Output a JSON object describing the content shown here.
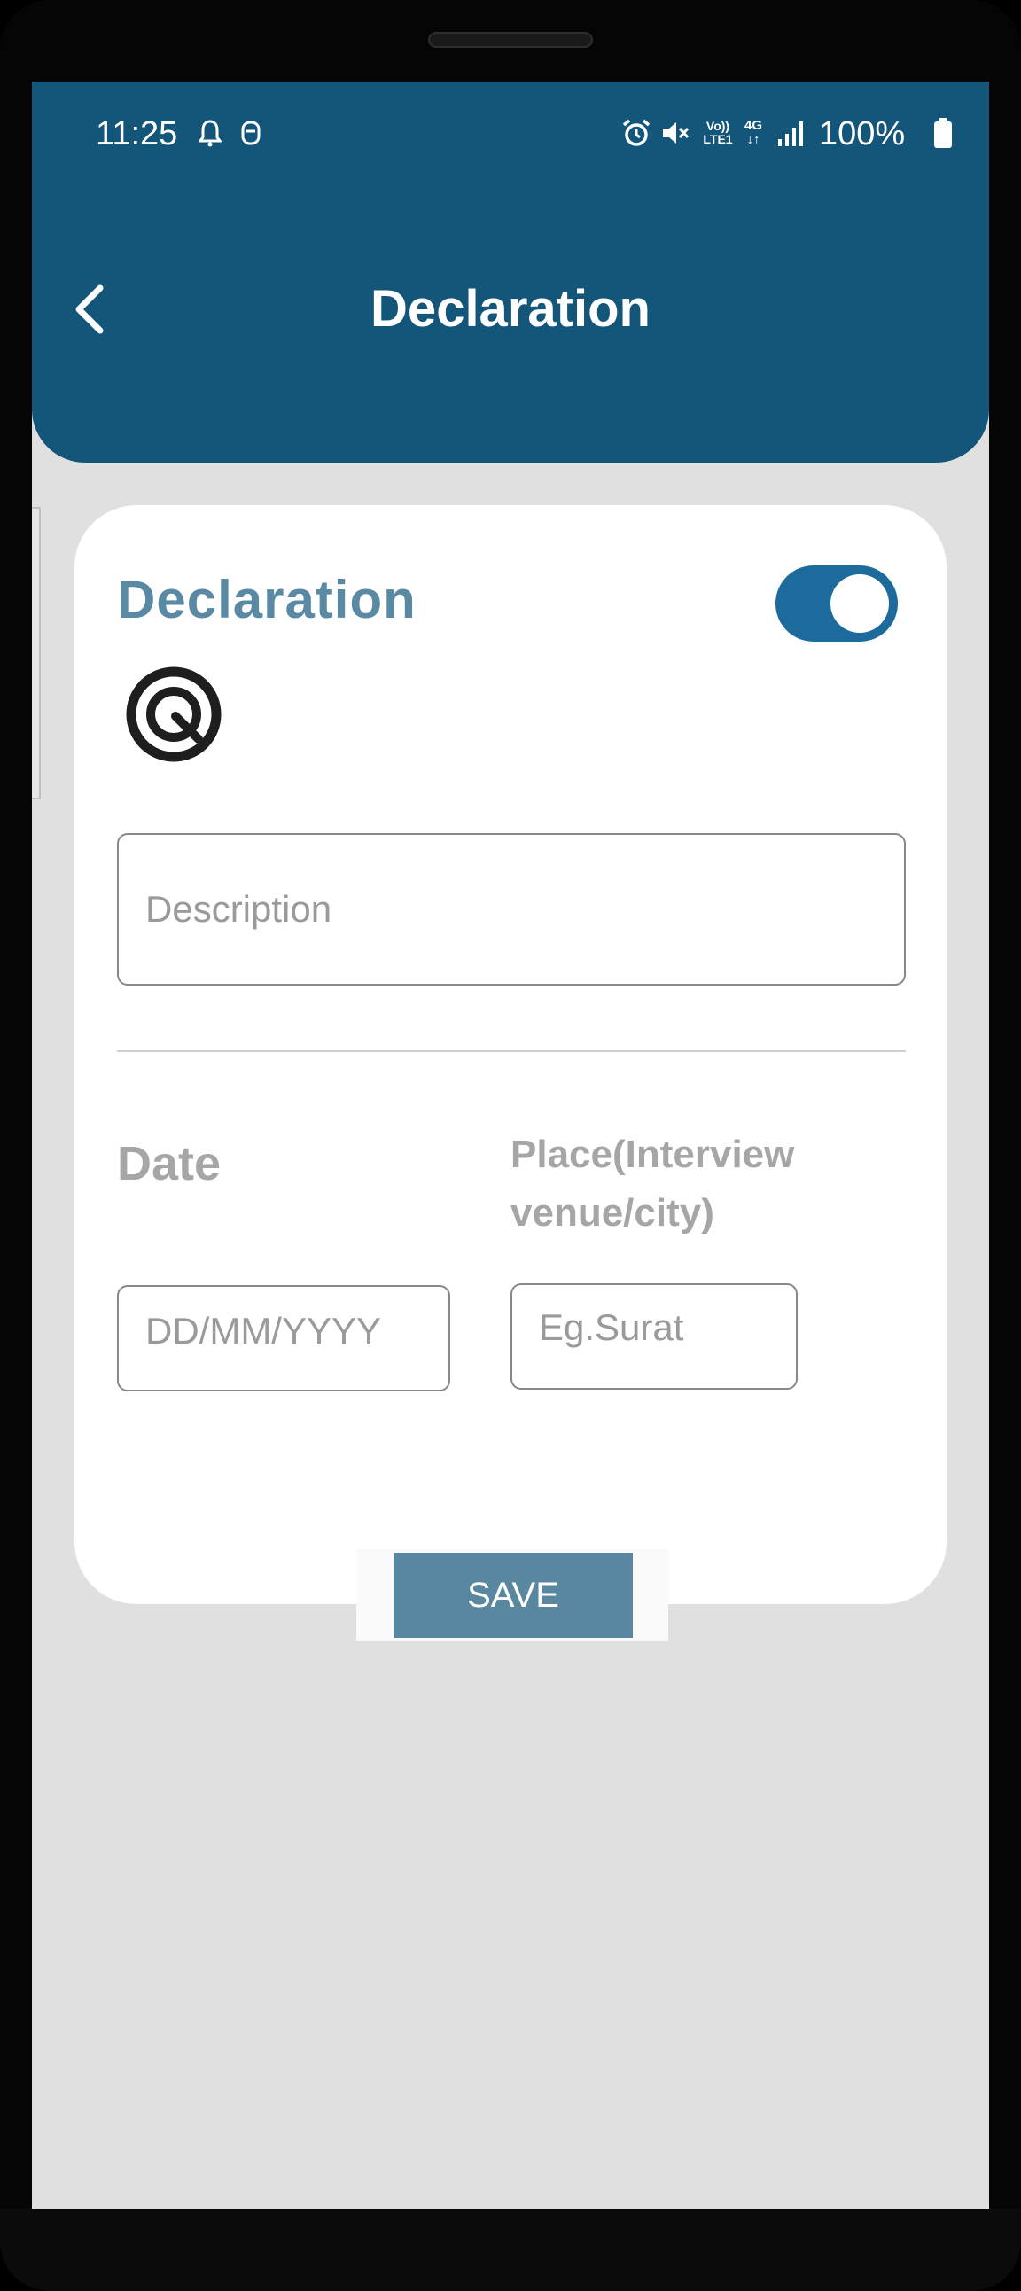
{
  "status_bar": {
    "time": "11:25",
    "battery": "100%",
    "icons": [
      "bell-icon",
      "notification-badge-icon",
      "alarm-icon",
      "mute-icon",
      "volte-icon",
      "4g-icon",
      "signal-icon",
      "battery-icon"
    ],
    "volte_text": "Vo))\nLTE1",
    "network_text": "4G"
  },
  "header": {
    "title": "Declaration",
    "back_icon": "chevron-left-icon",
    "color": "#14557a"
  },
  "card": {
    "title": "Declaration",
    "toggle_on": true,
    "target_icon": "target-icon",
    "description_placeholder": "Description",
    "date_label": "Date",
    "date_placeholder": "DD/MM/YYYY",
    "place_label": "Place(Interview venue/city)",
    "place_placeholder": "Eg.Surat",
    "save_label": "SAVE"
  },
  "colors": {
    "accent": "#1d6a9c",
    "title_text": "#5a89a3",
    "button": "#5987a0",
    "background": "#e0e0e0"
  }
}
